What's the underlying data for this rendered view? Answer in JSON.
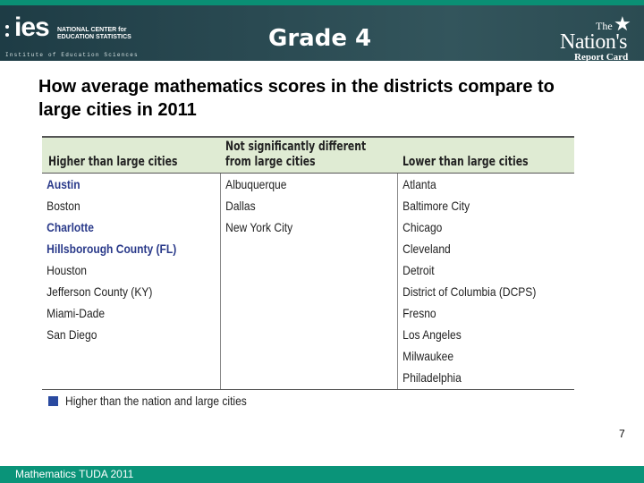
{
  "header": {
    "ies_logo": {
      "word": "ies",
      "line1": "NATIONAL CENTER for",
      "line2": "EDUCATION STATISTICS",
      "institute": "Institute of Education Sciences"
    },
    "grade_title": "Grade 4",
    "nrc_logo": {
      "the": "The",
      "nations": "Nation's",
      "report_card": "Report Card",
      "star": "★"
    }
  },
  "slide": {
    "title": "How average mathematics scores in the districts compare to large cities in 2011"
  },
  "table": {
    "columns": [
      {
        "header": "Higher than large cities",
        "items": [
          {
            "name": "Austin",
            "highlight": true
          },
          {
            "name": "Boston",
            "highlight": false
          },
          {
            "name": "Charlotte",
            "highlight": true
          },
          {
            "name": "Hillsborough County (FL)",
            "highlight": true
          },
          {
            "name": "Houston",
            "highlight": false
          },
          {
            "name": "Jefferson County (KY)",
            "highlight": false
          },
          {
            "name": "Miami-Dade",
            "highlight": false
          },
          {
            "name": "San Diego",
            "highlight": false
          }
        ]
      },
      {
        "header_line1": "Not significantly different",
        "header_line2": "from large cities",
        "items": [
          {
            "name": "Albuquerque",
            "highlight": false
          },
          {
            "name": "Dallas",
            "highlight": false
          },
          {
            "name": "New York City",
            "highlight": false
          }
        ]
      },
      {
        "header": "Lower than large cities",
        "items": [
          {
            "name": "Atlanta",
            "highlight": false
          },
          {
            "name": "Baltimore City",
            "highlight": false
          },
          {
            "name": "Chicago",
            "highlight": false
          },
          {
            "name": "Cleveland",
            "highlight": false
          },
          {
            "name": "Detroit",
            "highlight": false
          },
          {
            "name": "District of Columbia (DCPS)",
            "highlight": false
          },
          {
            "name": "Fresno",
            "highlight": false
          },
          {
            "name": "Los Angeles",
            "highlight": false
          },
          {
            "name": "Milwaukee",
            "highlight": false
          },
          {
            "name": "Philadelphia",
            "highlight": false
          }
        ]
      }
    ],
    "legend": {
      "label": "Higher than the nation and large cities",
      "color": "#2a4aa0"
    }
  },
  "page_number": "7",
  "footer": {
    "text": "Mathematics TUDA 2011"
  },
  "colors": {
    "header_accent": "#0a8f74",
    "header_bg": "#2a4a52",
    "table_header_bg": "#dfebd3",
    "highlight_text": "#2a3a8a"
  }
}
